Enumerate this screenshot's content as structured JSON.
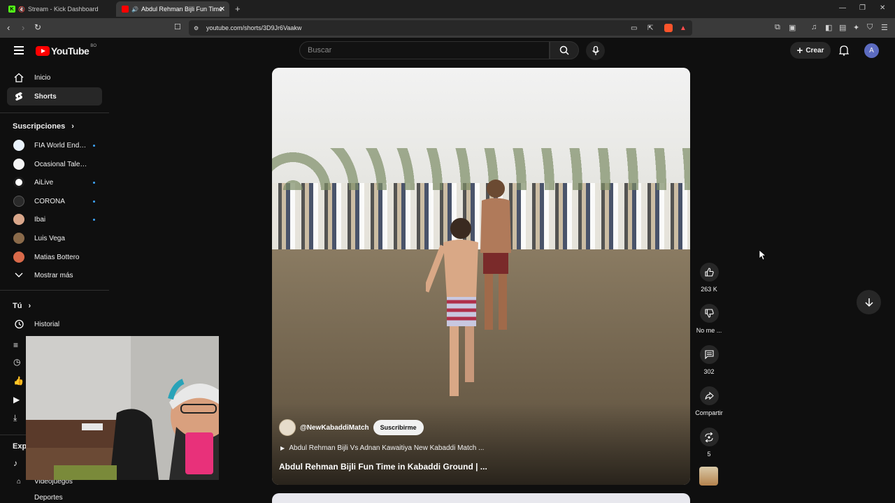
{
  "browser": {
    "tabs": [
      {
        "title": "Stream - Kick Dashboard",
        "favicon": "kick-icon",
        "active": false
      },
      {
        "title": "Abdul Rehman Bijli Fun Time",
        "favicon": "youtube-icon",
        "active": true
      }
    ],
    "url": "youtube.com/shorts/3D9Jr6Vaakw"
  },
  "header": {
    "logo_text": "YouTube",
    "logo_country": "BO",
    "search_placeholder": "Buscar",
    "create_label": "Crear",
    "avatar_letter": "A"
  },
  "sidebar": {
    "main": [
      {
        "label": "Inicio",
        "icon": "home-icon"
      },
      {
        "label": "Shorts",
        "icon": "shorts-icon",
        "active": true
      }
    ],
    "subs_heading": "Suscripciones",
    "subscriptions": [
      {
        "label": "FIA World Endur...",
        "color": "#e9f2fb",
        "dot": true
      },
      {
        "label": "Ocasional Talento - ...",
        "color": "#f5f5f5",
        "dot": false
      },
      {
        "label": "AiLive",
        "color": "#ffffff",
        "dot": true
      },
      {
        "label": "CORONA",
        "color": "#2a2a2a",
        "dot": true
      },
      {
        "label": "Ibai",
        "color": "#d9a68a",
        "dot": true
      },
      {
        "label": "Luis Vega",
        "color": "#8a6a4a",
        "dot": false
      },
      {
        "label": "Matias Bottero",
        "color": "#d96a4a",
        "dot": false
      }
    ],
    "show_more": "Mostrar más",
    "you_heading": "Tú",
    "history": "Historial",
    "explore_partial": "Expl",
    "videogames": "Videojuegos",
    "sports_partial": "Deportes"
  },
  "short": {
    "channel": "@NewKabaddiMatch",
    "subscribe_label": "Suscribirme",
    "playlist": "Abdul Rehman Bijli Vs Adnan Kawaitiya New Kabaddi Match ...",
    "title": "Abdul Rehman Bijli Fun Time in Kabaddi Ground | ...",
    "likes": "263 K",
    "dislike_label": "No me ...",
    "comments": "302",
    "share_label": "Compartir",
    "remix_count": "5"
  }
}
